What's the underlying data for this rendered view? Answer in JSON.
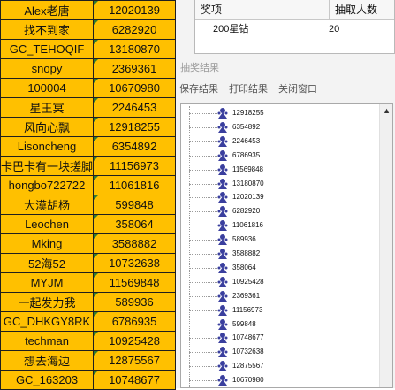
{
  "sheet": {
    "rows": [
      {
        "name": "Alex老唐",
        "id": "12020139"
      },
      {
        "name": "找不到家",
        "id": "6282920"
      },
      {
        "name": "GC_TEHOQIF",
        "id": "13180870"
      },
      {
        "name": "snopy",
        "id": "2369361"
      },
      {
        "name": "100004",
        "id": "10670980"
      },
      {
        "name": "星王冥",
        "id": "2246453"
      },
      {
        "name": "风向心飘",
        "id": "12918255"
      },
      {
        "name": "Lisoncheng",
        "id": "6354892"
      },
      {
        "name": "卡巴卡有一块搓脚",
        "id": "11156973"
      },
      {
        "name": "hongbo722722",
        "id": "11061816"
      },
      {
        "name": "大漠胡杨",
        "id": "599848"
      },
      {
        "name": "Leochen",
        "id": "358064"
      },
      {
        "name": "Mking",
        "id": "3588882"
      },
      {
        "name": "52海52",
        "id": "10732638"
      },
      {
        "name": "MYJM",
        "id": "11569848"
      },
      {
        "name": "一起发力我",
        "id": "589936"
      },
      {
        "name": "GC_DHKGY8RK",
        "id": "6786935"
      },
      {
        "name": "techman",
        "id": "10925428"
      },
      {
        "name": "想去海边",
        "id": "12875567"
      },
      {
        "name": "GC_163203",
        "id": "10748677"
      }
    ]
  },
  "prize_table": {
    "col_prize": "奖项",
    "col_count": "抽取人数",
    "rows": [
      {
        "prize": "200星钻",
        "count": "20"
      }
    ]
  },
  "draw_results": {
    "title": "抽奖结果",
    "save_label": "保存结果",
    "print_label": "打印结果",
    "close_label": "关闭窗口",
    "items": [
      "12918255",
      "6354892",
      "2246453",
      "6786935",
      "11569848",
      "13180870",
      "12020139",
      "6282920",
      "11061816",
      "589936",
      "3588882",
      "358064",
      "10925428",
      "2369361",
      "11156973",
      "599848",
      "10748677",
      "10732638",
      "12875567",
      "10670980"
    ]
  },
  "icons": {
    "result_node": "prize-node-icon",
    "scroll_up": "scroll-up-arrow-icon"
  },
  "colors": {
    "sheet_fill": "#ffc000",
    "node_icon": "#3a3f9e"
  }
}
